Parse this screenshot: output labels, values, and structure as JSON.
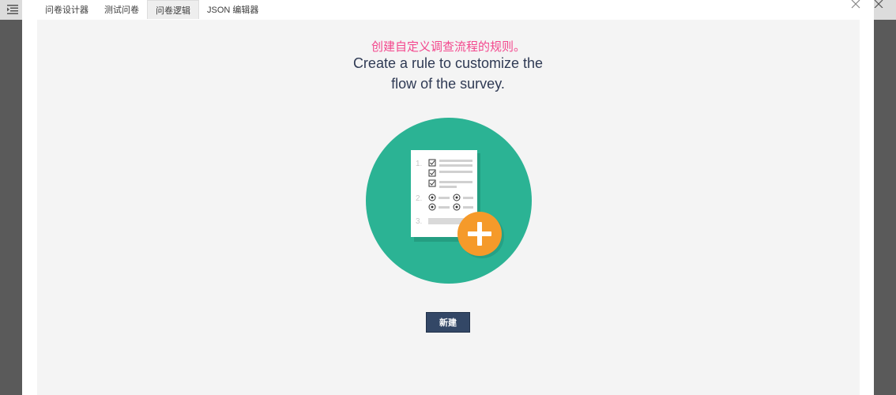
{
  "tabs": [
    {
      "label": "问卷设计器",
      "active": false
    },
    {
      "label": "测试问卷",
      "active": false
    },
    {
      "label": "问卷逻辑",
      "active": true
    },
    {
      "label": "JSON 编辑器",
      "active": false
    }
  ],
  "main": {
    "subtitle_cn": "创建自定义调查流程的规则。",
    "title_en": "Create a rule to customize the flow of the survey.",
    "new_button_label": "新建"
  },
  "illustration": {
    "list_numbers": [
      "1.",
      "2.",
      "3."
    ],
    "colors": {
      "circle": "#2bb394",
      "plus_badge": "#f59a2a",
      "accent_pink": "#f3478d",
      "button": "#334766"
    }
  },
  "icons": [
    "menu-icon",
    "close-icon",
    "survey-list-icon",
    "plus-icon",
    "checkbox-icon",
    "radio-icon"
  ]
}
